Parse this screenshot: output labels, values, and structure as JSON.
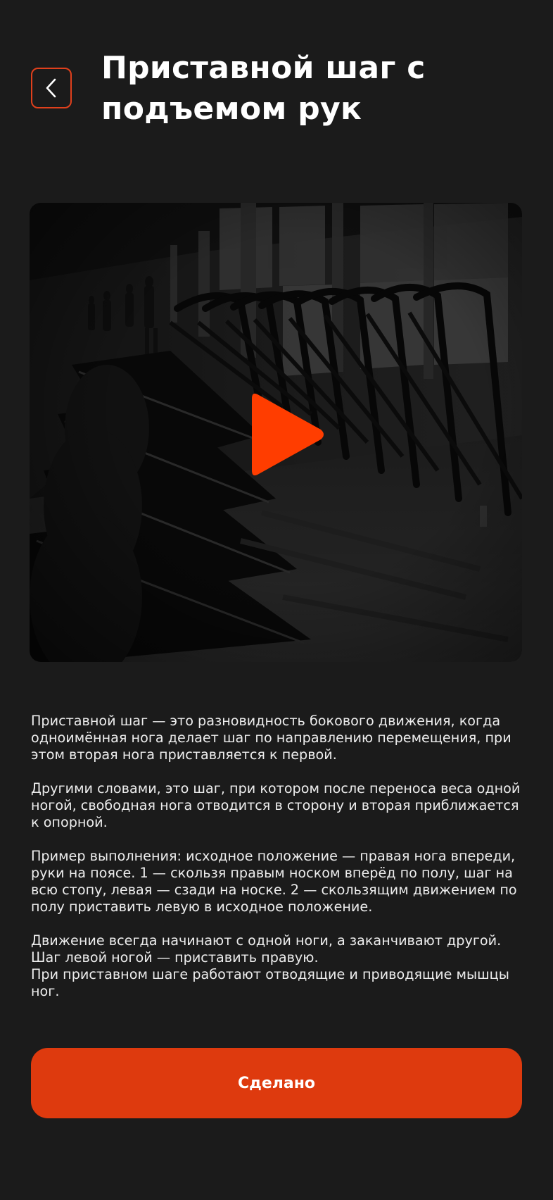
{
  "header": {
    "title": "Приставной шаг с подъемом рук",
    "back_icon": "chevron-left-icon"
  },
  "video": {
    "play_icon": "play-icon",
    "accent_color": "#ff3d00"
  },
  "description": {
    "paragraphs": [
      "Приставной шаг — это разновидность бокового движения, когда одноимённая нога делает шаг по направлению перемещения, при этом вторая нога приставляется к первой.",
      "Другими словами, это шаг, при котором после переноса веса одной ногой, свободная нога отводится в сторону и вторая приближается к опорной.",
      "Пример выполнения: исходное положение — правая нога впереди, руки на поясе. 1 — скользя правым носком вперёд по полу, шаг на всю стопу, левая — сзади на носке. 2 — скользящим движением по полу приставить левую в исходное положение.",
      "Движение всегда начинают с одной ноги, а заканчивают другой.",
      "Шаг левой ногой — приставить правую.",
      "При приставном шаге работают отводящие и приводящие мышцы ног."
    ]
  },
  "actions": {
    "done_label": "Сделано",
    "done_color": "#de3a0e"
  },
  "theme": {
    "background": "#1b1b1b",
    "accent": "#e0401c"
  }
}
